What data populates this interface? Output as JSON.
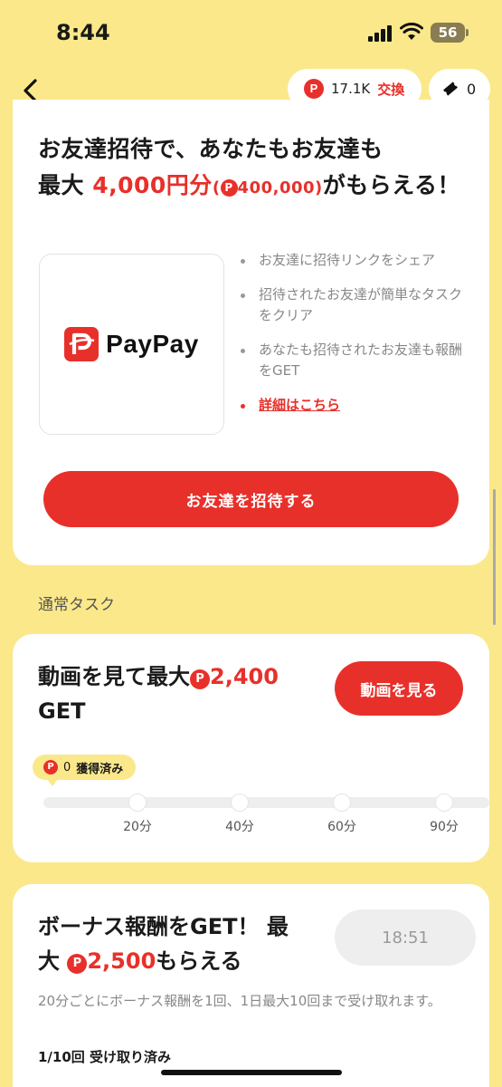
{
  "status_bar": {
    "time": "8:44",
    "battery": "56"
  },
  "header": {
    "points": "17.1K",
    "exchange_label": "交換",
    "tickets": "0",
    "point_symbol": "P"
  },
  "invite": {
    "title_line1": "お友達招待で、あなたもお友達も",
    "title_prefix": "最大",
    "title_amount": "4,000円分",
    "title_points_open": "(",
    "title_points": "400,000",
    "title_points_close": ")",
    "title_suffix": "がもらえる！",
    "brand": "PayPay",
    "steps": [
      "お友達に招待リンクをシェア",
      "招待されたお友達が簡単なタスクをクリア",
      "あなたも招待されたお友達も報酬をGET"
    ],
    "details_link": "詳細はこちら",
    "invite_button": "お友達を招待する"
  },
  "section_label": "通常タスク",
  "video_task": {
    "title_prefix": "動画を見て最大",
    "title_points": "2,400",
    "title_suffix": "GET",
    "button": "動画を見る",
    "acquired_points": "0",
    "acquired_label": "獲得済み",
    "progress": 0,
    "milestones": [
      "20分",
      "40分",
      "60分",
      "90分"
    ]
  },
  "bonus_task": {
    "title_part1": "ボーナス報酬をGET！ 最大",
    "title_points": "2,500",
    "title_suffix": "もらえる",
    "timer": "18:51",
    "description": "20分ごとにボーナス報酬を1回、1日最大10回まで受け取れます。",
    "claimed": "1/10回 受け取り済み"
  },
  "colors": {
    "background": "#fbe88a",
    "accent": "#e8302a"
  }
}
